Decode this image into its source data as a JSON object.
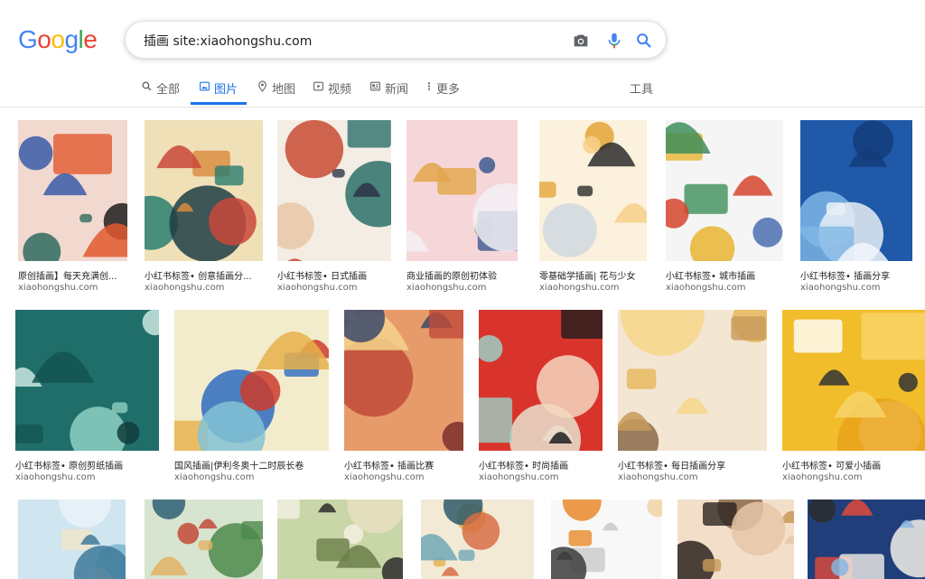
{
  "logo": {
    "letters": [
      "G",
      "o",
      "o",
      "g",
      "l",
      "e"
    ],
    "colors": [
      "#4285F4",
      "#EA4335",
      "#FBBC05",
      "#4285F4",
      "#34A853",
      "#EA4335"
    ]
  },
  "search": {
    "query": "插画 site:xiaohongshu.com"
  },
  "tabs": [
    {
      "label": "全部",
      "icon": "search-icon"
    },
    {
      "label": "图片",
      "icon": "image-icon",
      "active": true
    },
    {
      "label": "地图",
      "icon": "map-pin-icon"
    },
    {
      "label": "视频",
      "icon": "play-icon"
    },
    {
      "label": "新闻",
      "icon": "news-icon"
    },
    {
      "label": "更多",
      "icon": "more-vert-icon"
    }
  ],
  "tools_label": "工具",
  "colors": {
    "accent": "#1a73e8"
  },
  "results": [
    [
      {
        "caption": "原创插画】每天充满创...",
        "domain": "xiaohongshu.com",
        "palette": [
          "#f2d9cf",
          "#2f6b5e",
          "#e2592f",
          "#3a5aa8",
          "#1d1d1d"
        ]
      },
      {
        "caption": "小红书标签• 创意插画分...",
        "domain": "xiaohongshu.com",
        "palette": [
          "#f0e0b8",
          "#2a7d6e",
          "#d98a3c",
          "#c9473a",
          "#1e3d44"
        ]
      },
      {
        "caption": "小红书标签• 日式插画",
        "domain": "xiaohongshu.com",
        "palette": [
          "#f3ede4",
          "#2c6e6a",
          "#2b3447",
          "#c84b34",
          "#e8c7a8"
        ]
      },
      {
        "caption": "商业插画的原创初体验",
        "domain": "xiaohongshu.com",
        "palette": [
          "#f6d7d9",
          "#3c5a8f",
          "#e4a64a",
          "#f2f0f4",
          "#5e8f6b"
        ]
      },
      {
        "caption": "零基础学插画| 花与少女",
        "domain": "xiaohongshu.com",
        "palette": [
          "#fbf1dc",
          "#e5a53a",
          "#2d2d2d",
          "#f7d08a",
          "#cfd8df"
        ]
      },
      {
        "caption": "小红书标签• 城市插画",
        "domain": "xiaohongshu.com",
        "palette": [
          "#f5f5f5",
          "#e8b533",
          "#3e8e5a",
          "#d6452e",
          "#4a6fb0"
        ]
      },
      {
        "caption": "小红书标签• 插画分享",
        "domain": "xiaohongshu.com",
        "palette": [
          "#1f59a8",
          "#7fb6e6",
          "#f2f7fb",
          "#143c7a",
          "#e8eef5"
        ]
      }
    ],
    [
      {
        "caption": "小红书标签• 原创剪纸插画",
        "domain": "xiaohongshu.com",
        "palette": [
          "#1f6e6a",
          "#8fd0c2",
          "#145450",
          "#cbe8df",
          "#0f3d3c"
        ]
      },
      {
        "caption": "国风插画|伊利冬奥十二时辰长卷",
        "domain": "xiaohongshu.com",
        "palette": [
          "#f3eccc",
          "#2e6cc0",
          "#e6b04a",
          "#cc3b2d",
          "#82c3d4"
        ]
      },
      {
        "caption": "小红书标签• 插画比赛",
        "domain": "xiaohongshu.com",
        "palette": [
          "#e89b6a",
          "#c14a3a",
          "#f5d38c",
          "#3a4a6b",
          "#7a2f2c"
        ]
      },
      {
        "caption": "小红书标签• 时尚插画",
        "domain": "xiaohongshu.com",
        "palette": [
          "#d8342b",
          "#9fcfc6",
          "#1e1e1e",
          "#f5d7c0",
          "#e9e2cf"
        ]
      },
      {
        "caption": "小红书标签• 每日插画分享",
        "domain": "xiaohongshu.com",
        "palette": [
          "#f3e6d3",
          "#e7b65a",
          "#c79a5a",
          "#f6d68a",
          "#8a6a4a"
        ]
      },
      {
        "caption": "小红书标签• 可爱小插画",
        "domain": "xiaohongshu.com",
        "palette": [
          "#f2bd2b",
          "#ffffff",
          "#f7d46a",
          "#333333",
          "#e9a21a"
        ]
      }
    ],
    [
      {
        "caption": "",
        "domain": "",
        "palette": [
          "#cfe5ef",
          "#7db6cf",
          "#f1e6c9",
          "#3e7a9a",
          "#e9f3f7"
        ]
      },
      {
        "caption": "",
        "domain": "",
        "palette": [
          "#d7e4cf",
          "#4e8a4b",
          "#e3b365",
          "#c44a38",
          "#2f5f74"
        ]
      },
      {
        "caption": "",
        "domain": "",
        "palette": [
          "#c9d6a8",
          "#f4f0e2",
          "#6b7f4a",
          "#2c2c2c",
          "#e6dfc2"
        ]
      },
      {
        "caption": "",
        "domain": "",
        "palette": [
          "#f3ead6",
          "#e5b14a",
          "#6fa8b6",
          "#d76e45",
          "#2d5a6a"
        ]
      },
      {
        "caption": "",
        "domain": "",
        "palette": [
          "#f8f8f8",
          "#e88a2a",
          "#c9c9c9",
          "#3c3c3c",
          "#f2d3a6"
        ]
      },
      {
        "caption": "",
        "domain": "",
        "palette": [
          "#f3dfc9",
          "#2b2420",
          "#c89a5a",
          "#e7c7a8",
          "#8c6a4a"
        ]
      },
      {
        "caption": "",
        "domain": "",
        "palette": [
          "#1f3e7a",
          "#f3f0e8",
          "#e24a3a",
          "#88b7e0",
          "#2c2c2c"
        ]
      }
    ]
  ]
}
